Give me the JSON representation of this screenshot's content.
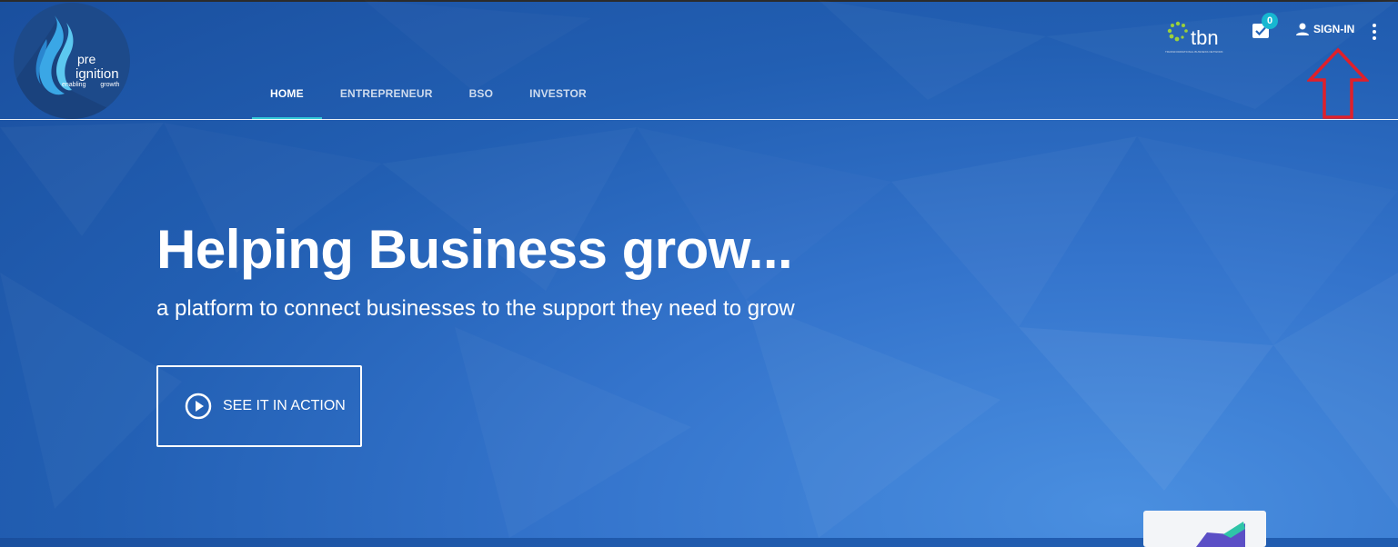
{
  "logo": {
    "line1": "pre",
    "line2": "ignition",
    "tagline": "enabling growth"
  },
  "nav": {
    "items": [
      "HOME",
      "ENTREPRENEUR",
      "BSO",
      "INVESTOR"
    ],
    "active": "HOME"
  },
  "partner": {
    "name": "tbn",
    "subtitle": "TRANSFORMATIONAL BUSINESS NETWORK"
  },
  "inbox": {
    "badge": "0"
  },
  "signin": {
    "label": "SIGN-IN"
  },
  "hero": {
    "title": "Helping Business grow...",
    "subtitle": "a platform to connect businesses to the support they need to grow",
    "cta": "SEE IT IN ACTION"
  },
  "colors": {
    "accent": "#33c9d8",
    "badge": "#17b7d1",
    "annotation": "#e0202a"
  },
  "icons": {
    "inbox": "inbox-check-icon",
    "user": "person-icon",
    "more": "more-vert-icon",
    "play": "play-circle-icon"
  }
}
